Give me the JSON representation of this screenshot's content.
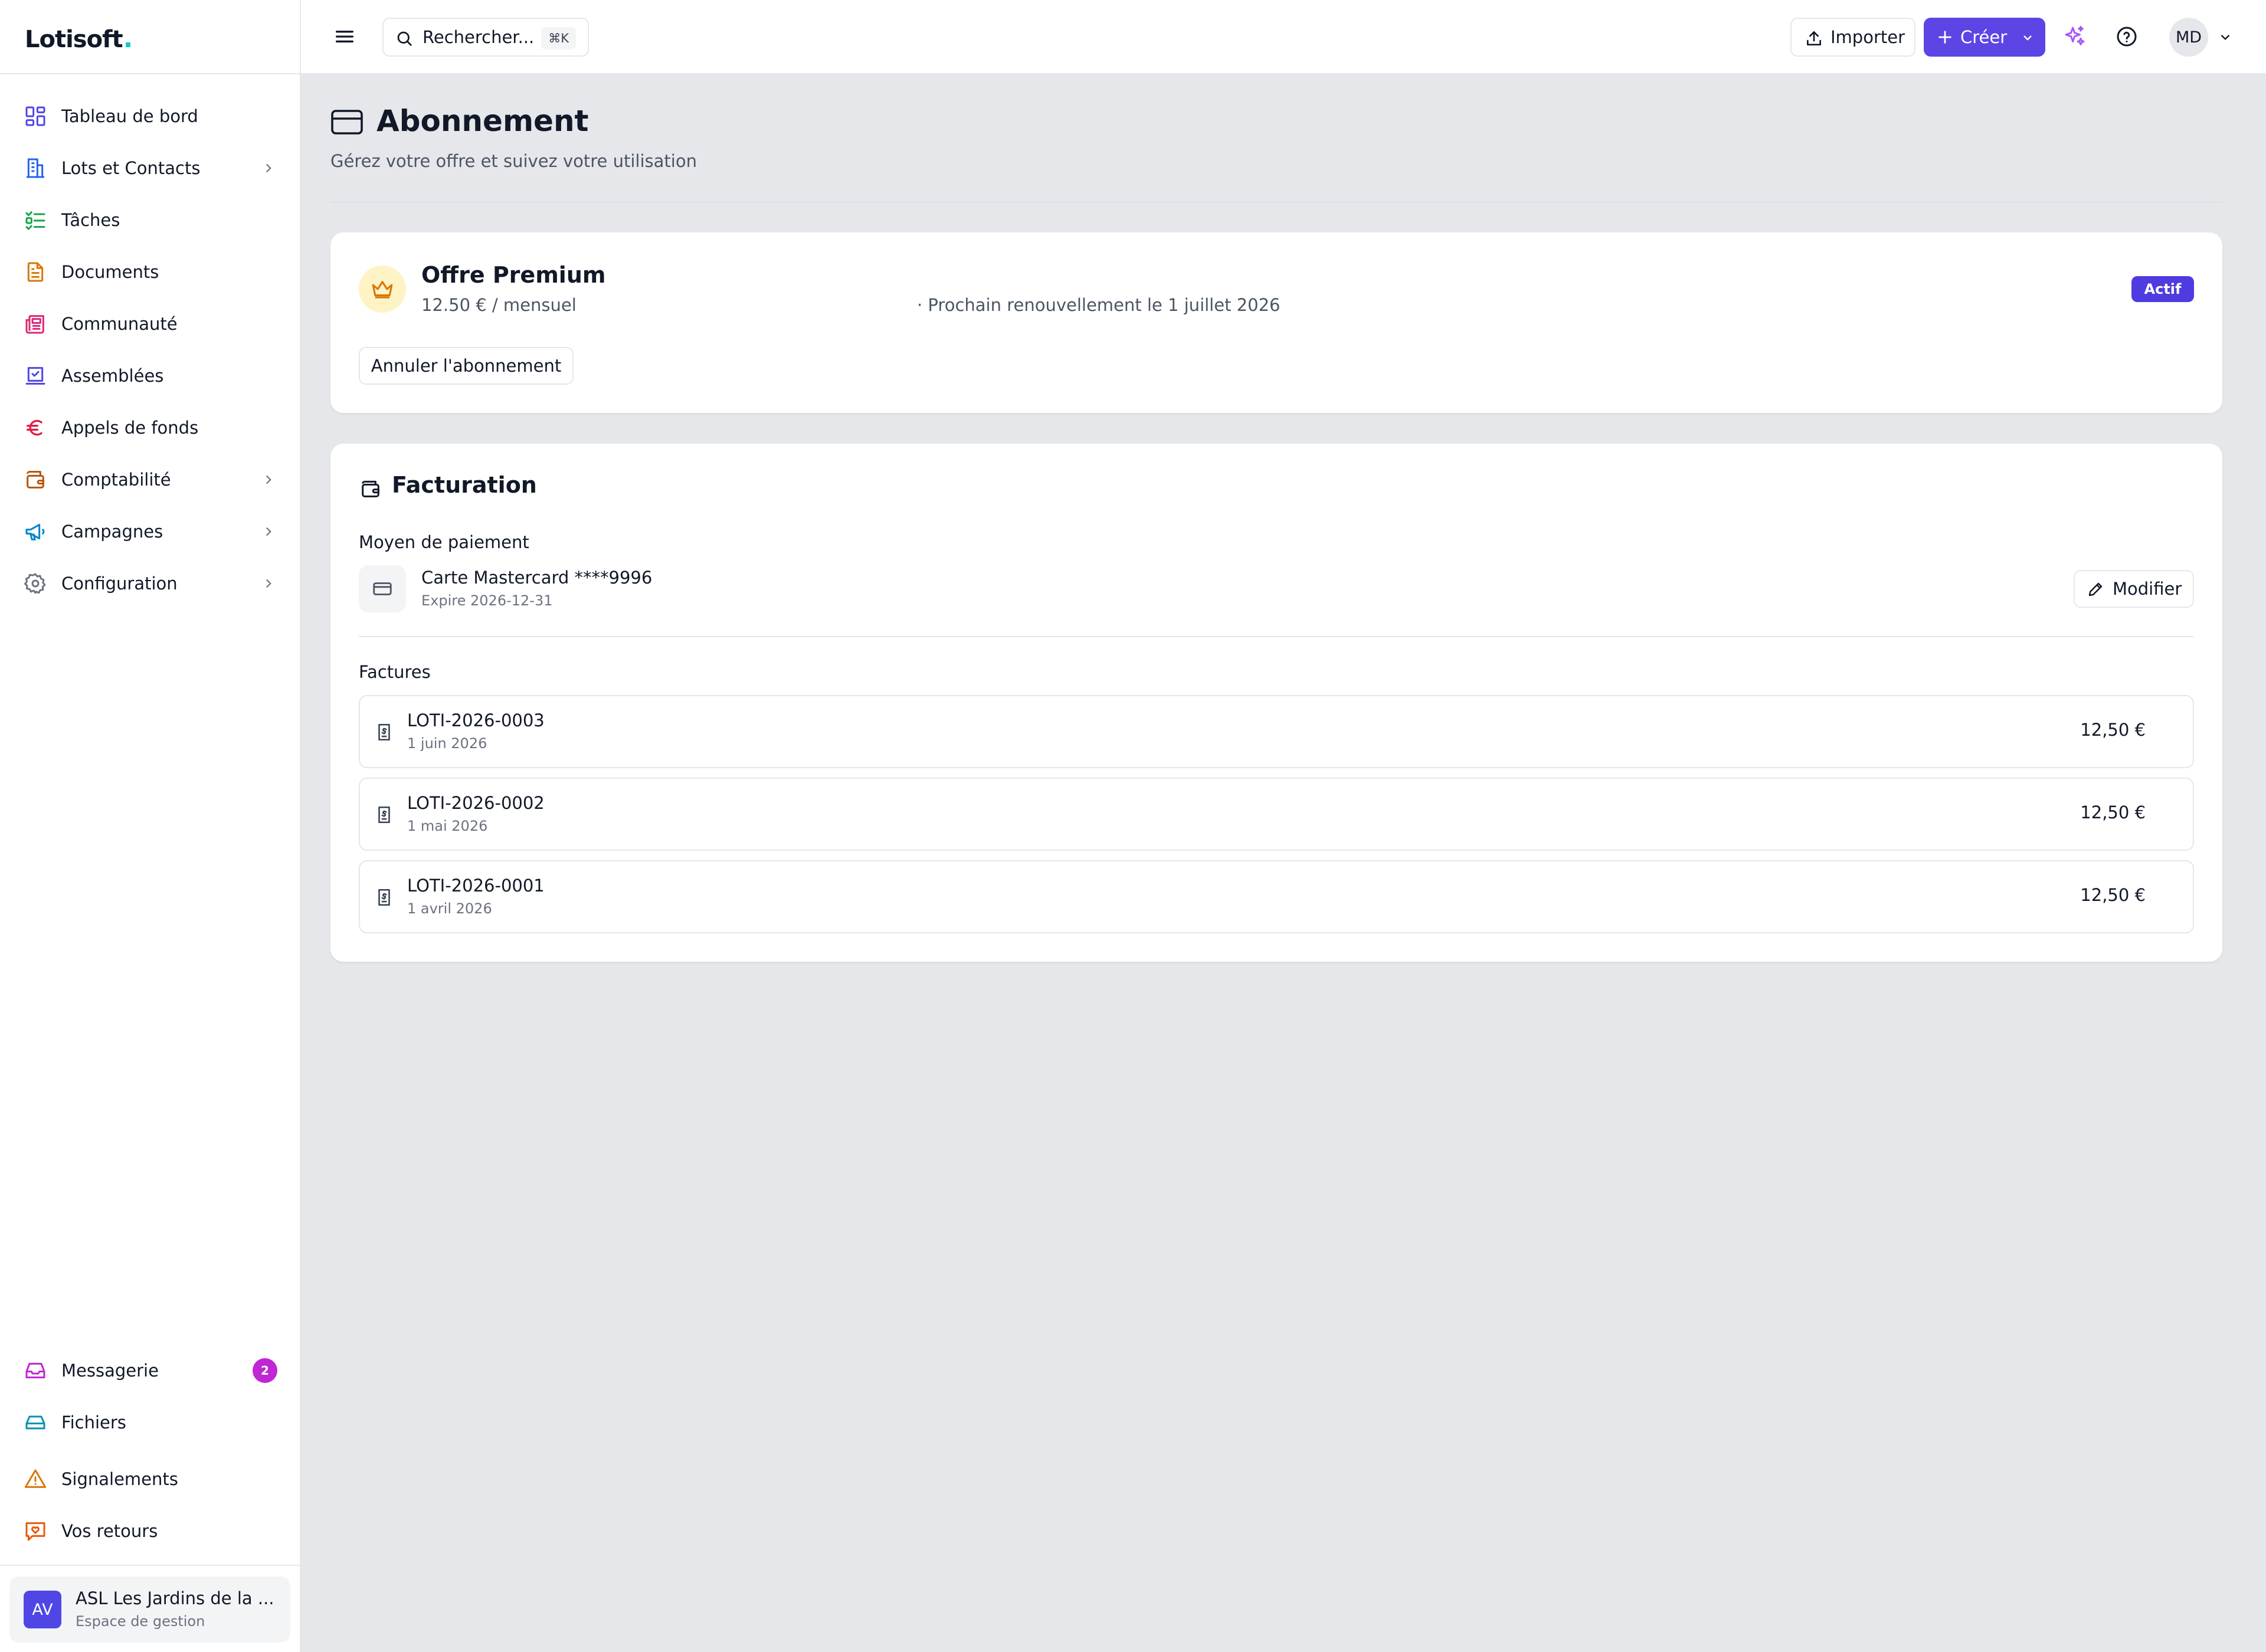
{
  "brand": {
    "name": "Lotisoft",
    "dot": ".",
    "dot_color": "#14c8c8"
  },
  "sidebar": {
    "items": [
      {
        "label": "Tableau de bord",
        "icon": "dashboard-icon",
        "color": "#4f46e5"
      },
      {
        "label": "Lots et Contacts",
        "icon": "building-icon",
        "color": "#2563eb",
        "expandable": true
      },
      {
        "label": "Tâches",
        "icon": "tasks-icon",
        "color": "#16a34a"
      },
      {
        "label": "Documents",
        "icon": "document-icon",
        "color": "#d97706"
      },
      {
        "label": "Communauté",
        "icon": "newspaper-icon",
        "color": "#db2777"
      },
      {
        "label": "Assemblées",
        "icon": "vote-icon",
        "color": "#4f46e5"
      },
      {
        "label": "Appels de fonds",
        "icon": "euro-icon",
        "color": "#e11d48"
      },
      {
        "label": "Comptabilité",
        "icon": "wallet-icon",
        "color": "#b45309",
        "expandable": true
      },
      {
        "label": "Campagnes",
        "icon": "megaphone-icon",
        "color": "#0284c7",
        "expandable": true
      },
      {
        "label": "Configuration",
        "icon": "gear-icon",
        "color": "#6b7280",
        "expandable": true
      }
    ],
    "bottom_items": [
      {
        "label": "Messagerie",
        "icon": "inbox-icon",
        "color": "#c026d3",
        "badge": "2"
      },
      {
        "label": "Fichiers",
        "icon": "drive-icon",
        "color": "#0891b2"
      },
      {
        "label": "Signalements",
        "icon": "warning-icon",
        "color": "#d97706"
      },
      {
        "label": "Vos retours",
        "icon": "feedback-icon",
        "color": "#ea580c"
      }
    ],
    "org": {
      "initials": "AV",
      "name": "ASL Les Jardins de la ...",
      "subtitle": "Espace de gestion"
    }
  },
  "topbar": {
    "search_placeholder": "Rechercher...",
    "search_shortcut": "⌘K",
    "import_label": "Importer",
    "create_label": "Créer",
    "accent": "#5b46e5",
    "user_initials": "MD"
  },
  "page": {
    "title": "Abonnement",
    "subtitle": "Gérez votre offre et suivez votre utilisation"
  },
  "plan": {
    "name": "Offre Premium",
    "price": "12.50 € / mensuel",
    "renewal": "· Prochain renouvellement le 1 juillet 2026",
    "status": "Actif",
    "cancel_label": "Annuler l'abonnement"
  },
  "billing": {
    "title": "Facturation",
    "payment_heading": "Moyen de paiement",
    "card_name": "Carte Mastercard ****9996",
    "card_expiry": "Expire 2026-12-31",
    "modify_label": "Modifier",
    "invoices_heading": "Factures",
    "invoices": [
      {
        "number": "LOTI-2026-0003",
        "date": "1 juin 2026",
        "amount": "12,50 €"
      },
      {
        "number": "LOTI-2026-0002",
        "date": "1 mai 2026",
        "amount": "12,50 €"
      },
      {
        "number": "LOTI-2026-0001",
        "date": "1 avril 2026",
        "amount": "12,50 €"
      }
    ]
  }
}
